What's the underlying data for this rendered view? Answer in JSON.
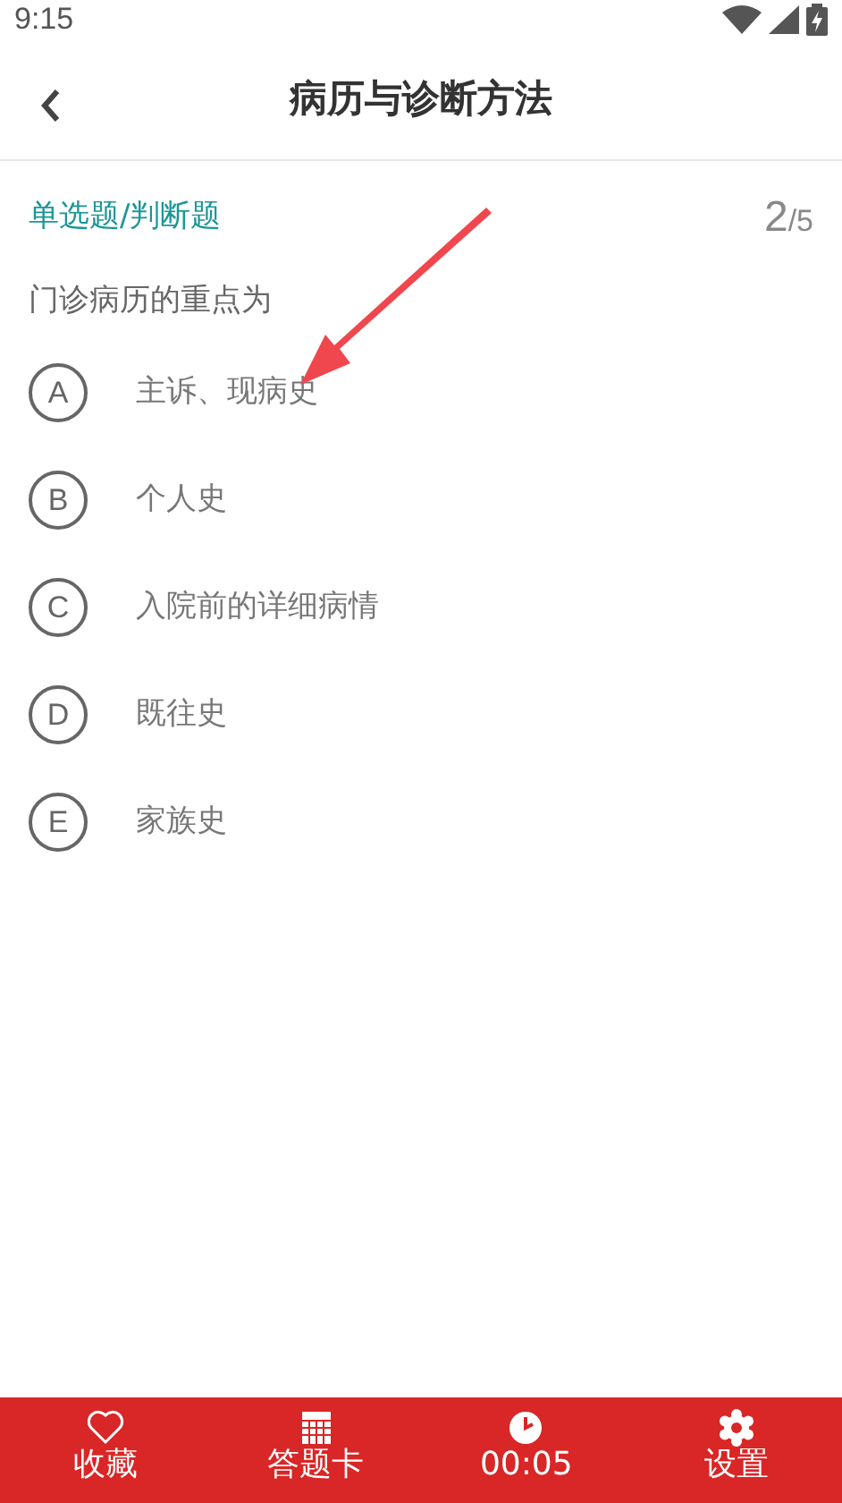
{
  "status_bar": {
    "time": "9:15"
  },
  "header": {
    "title": "病历与诊断方法"
  },
  "question": {
    "type": "单选题/判断题",
    "current": "2",
    "total": "/5",
    "text": "门诊病历的重点为",
    "options": [
      {
        "letter": "A",
        "text": "主诉、现病史",
        "selected": false
      },
      {
        "letter": "B",
        "text": "个人史",
        "selected": false
      },
      {
        "letter": "C",
        "text": "入院前的详细病情",
        "selected": false
      },
      {
        "letter": "D",
        "text": "既往史",
        "selected": false
      },
      {
        "letter": "E",
        "text": "家族史",
        "selected": false
      }
    ]
  },
  "bottom_bar": [
    {
      "kind": "heart",
      "label": "收藏"
    },
    {
      "kind": "grid",
      "label": "答题卡"
    },
    {
      "kind": "clock",
      "label": "00:05"
    },
    {
      "kind": "gear",
      "label": "设置"
    }
  ]
}
